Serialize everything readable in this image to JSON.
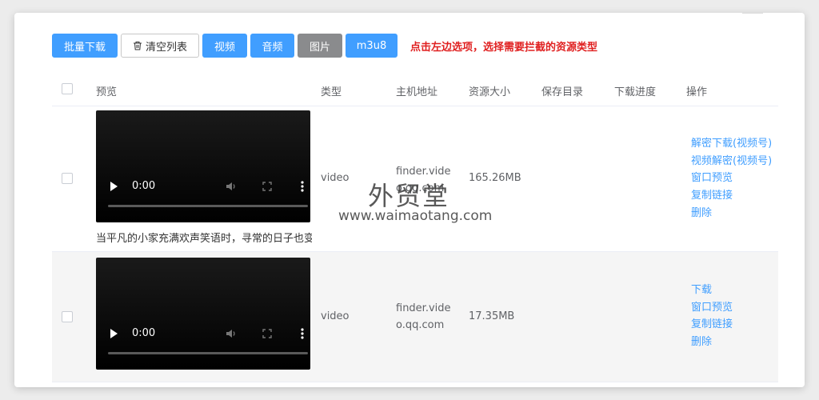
{
  "toolbar": {
    "batch_download": "批量下载",
    "clear_list": "清空列表",
    "filter_video": "视频",
    "filter_audio": "音频",
    "filter_image": "图片",
    "filter_m3u8": "m3u8",
    "hint": "点击左边选项，选择需要拦截的资源类型"
  },
  "table": {
    "columns": [
      "预览",
      "类型",
      "主机地址",
      "资源大小",
      "保存目录",
      "下载进度",
      "操作"
    ],
    "rows": [
      {
        "time": "0:00",
        "caption": "当平凡的小家充满欢声笑语时，寻常的日子也变",
        "type": "video",
        "host_line1": "finder.vide",
        "host_line2": "o.qq.com",
        "size": "165.26MB",
        "actions": [
          "解密下载(视频号)",
          "视频解密(视频号)",
          "窗口预览",
          "复制链接",
          "删除"
        ]
      },
      {
        "time": "0:00",
        "caption": "",
        "type": "video",
        "host_line1": "finder.vide",
        "host_line2": "o.qq.com",
        "size": "17.35MB",
        "actions": [
          "下载",
          "窗口预览",
          "复制链接",
          "删除"
        ]
      }
    ]
  },
  "watermark": {
    "brand": "外贸堂",
    "url": "www.waimaotang.com"
  }
}
